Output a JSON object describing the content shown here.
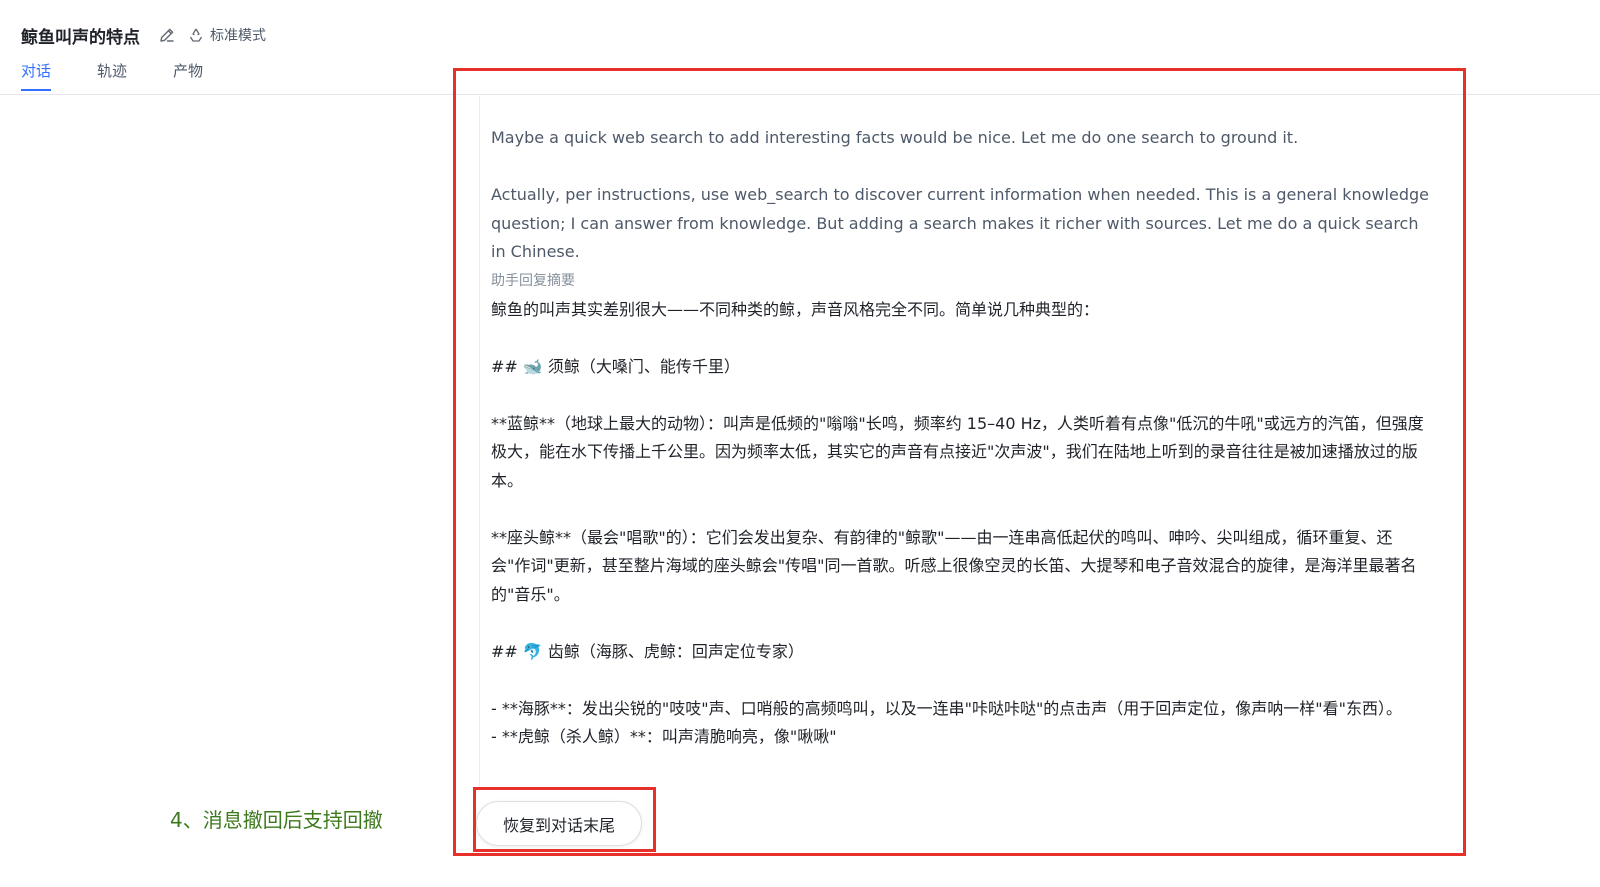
{
  "header": {
    "title": "鲸鱼叫声的特点",
    "mode_label": "标准模式",
    "tabs": [
      {
        "label": "对话",
        "active": true
      },
      {
        "label": "轨迹",
        "active": false
      },
      {
        "label": "产物",
        "active": false
      }
    ]
  },
  "message": {
    "thinking": [
      "Maybe a quick web search to add interesting facts would be nice. Let me do one search to ground it.",
      "Actually, per instructions, use web_search to discover current information when needed. This is a general knowledge question; I can answer from knowledge. But adding a search makes it richer with sources. Let me do a quick search in Chinese."
    ],
    "summary_label": "助手回复摘要",
    "summary_lines": [
      "鲸鱼的叫声其实差别很大——不同种类的鲸，声音风格完全不同。简单说几种典型的：",
      "## 🐋 须鲸（大嗓门、能传千里）",
      "**蓝鲸**（地球上最大的动物）：叫声是低频的\"嗡嗡\"长鸣，频率约 15–40 Hz，人类听着有点像\"低沉的牛吼\"或远方的汽笛，但强度极大，能在水下传播上千公里。因为频率太低，其实它的声音有点接近\"次声波\"，我们在陆地上听到的录音往往是被加速播放过的版本。",
      "**座头鲸**（最会\"唱歌\"的）：它们会发出复杂、有韵律的\"鲸歌\"——由一连串高低起伏的鸣叫、呻吟、尖叫组成，循环重复、还会\"作词\"更新，甚至整片海域的座头鲸会\"传唱\"同一首歌。听感上很像空灵的长笛、大提琴和电子音效混合的旋律，是海洋里最著名的\"音乐\"。",
      "## 🐬 齿鲸（海豚、虎鲸：回声定位专家）",
      "- **海豚**：发出尖锐的\"吱吱\"声、口哨般的高频鸣叫，以及一连串\"咔哒咔哒\"的点击声（用于回声定位，像声呐一样\"看\"东西）。",
      "- **虎鲸（杀人鲸）**：叫声清脆响亮，像\"啾啾\""
    ]
  },
  "restore_button_label": "恢复到对话末尾",
  "annotation": "4、消息撤回后支持回撤",
  "colors": {
    "accent": "#3370ff",
    "annotation_box": "#e8302a",
    "annotation_text": "#3d7a1e"
  }
}
